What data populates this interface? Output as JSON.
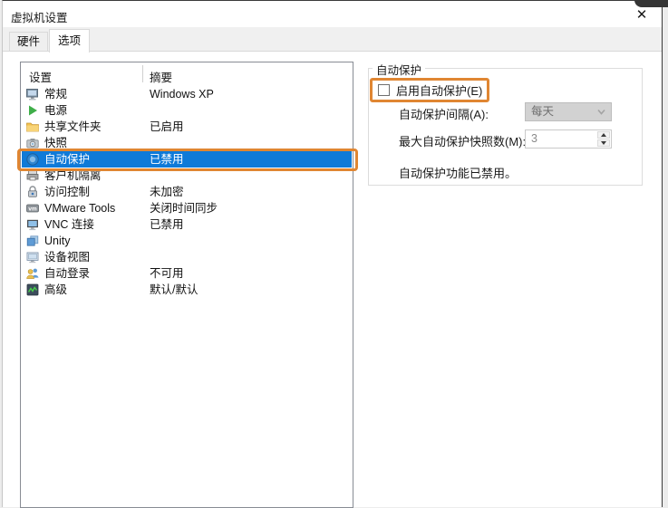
{
  "window": {
    "title": "虚拟机设置",
    "close_glyph": "✕"
  },
  "tabs": [
    {
      "label": "硬件",
      "active": false
    },
    {
      "label": "选项",
      "active": true
    }
  ],
  "list": {
    "columns": [
      "设置",
      "摘要"
    ],
    "items": [
      {
        "icon": "monitor-icon",
        "label": "常规",
        "summary": "Windows XP",
        "selected": false
      },
      {
        "icon": "power-icon",
        "label": "电源",
        "summary": "",
        "selected": false
      },
      {
        "icon": "folder-icon",
        "label": "共享文件夹",
        "summary": "已启用",
        "selected": false
      },
      {
        "icon": "camera-icon",
        "label": "快照",
        "summary": "",
        "selected": false
      },
      {
        "icon": "autoprotect-icon",
        "label": "自动保护",
        "summary": "已禁用",
        "selected": true
      },
      {
        "icon": "guest-isolation-icon",
        "label": "客户机隔离",
        "summary": "",
        "selected": false
      },
      {
        "icon": "lock-icon",
        "label": "访问控制",
        "summary": "未加密",
        "selected": false
      },
      {
        "icon": "vmware-tools-icon",
        "label": "VMware Tools",
        "summary": "关闭时间同步",
        "selected": false
      },
      {
        "icon": "vnc-icon",
        "label": "VNC 连接",
        "summary": "已禁用",
        "selected": false
      },
      {
        "icon": "unity-icon",
        "label": "Unity",
        "summary": "",
        "selected": false
      },
      {
        "icon": "device-view-icon",
        "label": "设备视图",
        "summary": "",
        "selected": false
      },
      {
        "icon": "autologin-icon",
        "label": "自动登录",
        "summary": "不可用",
        "selected": false
      },
      {
        "icon": "advanced-icon",
        "label": "高级",
        "summary": "默认/默认",
        "selected": false
      }
    ]
  },
  "panel": {
    "group_title": "自动保护",
    "checkbox_label": "启用自动保护(E)",
    "checkbox_checked": false,
    "interval_label": "自动保护间隔(A):",
    "interval_value": "每天",
    "max_snapshots_label": "最大自动保护快照数(M):",
    "max_snapshots_value": "3",
    "status_text": "自动保护功能已禁用。"
  },
  "colors": {
    "selection_blue": "#0f7ad8",
    "annotation_orange": "#e08632",
    "tabstrip_gray": "#f0f0f0"
  }
}
